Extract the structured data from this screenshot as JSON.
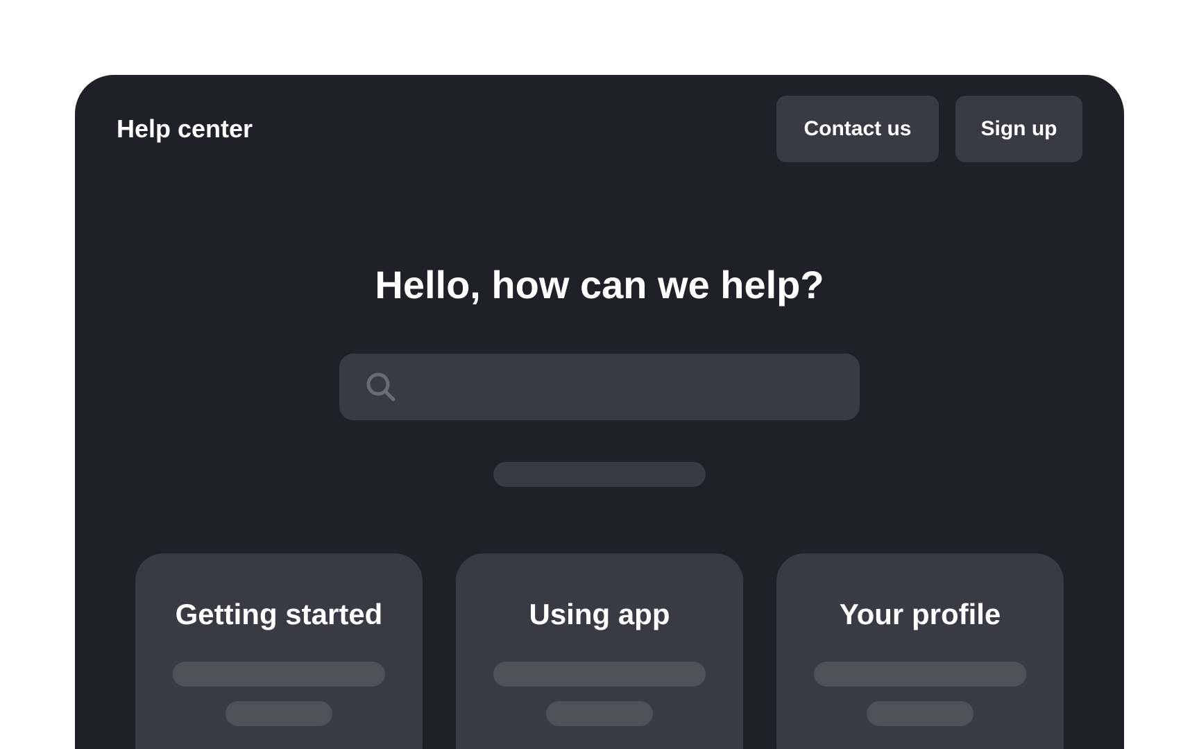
{
  "header": {
    "brand": "Help center",
    "contact_label": "Contact us",
    "signup_label": "Sign up"
  },
  "hero": {
    "headline": "Hello, how can we help?",
    "search": {
      "value": "",
      "placeholder": ""
    }
  },
  "categories": [
    {
      "title": "Getting started"
    },
    {
      "title": "Using app"
    },
    {
      "title": "Your profile"
    }
  ],
  "colors": {
    "page_background": "#ffffff",
    "frame_background": "#202128",
    "surface": "#3a3a44",
    "placeholder_bar": "#505158",
    "text": "#ffffff",
    "icon": "#6b6b73"
  },
  "icons": {
    "search": "search-icon"
  }
}
